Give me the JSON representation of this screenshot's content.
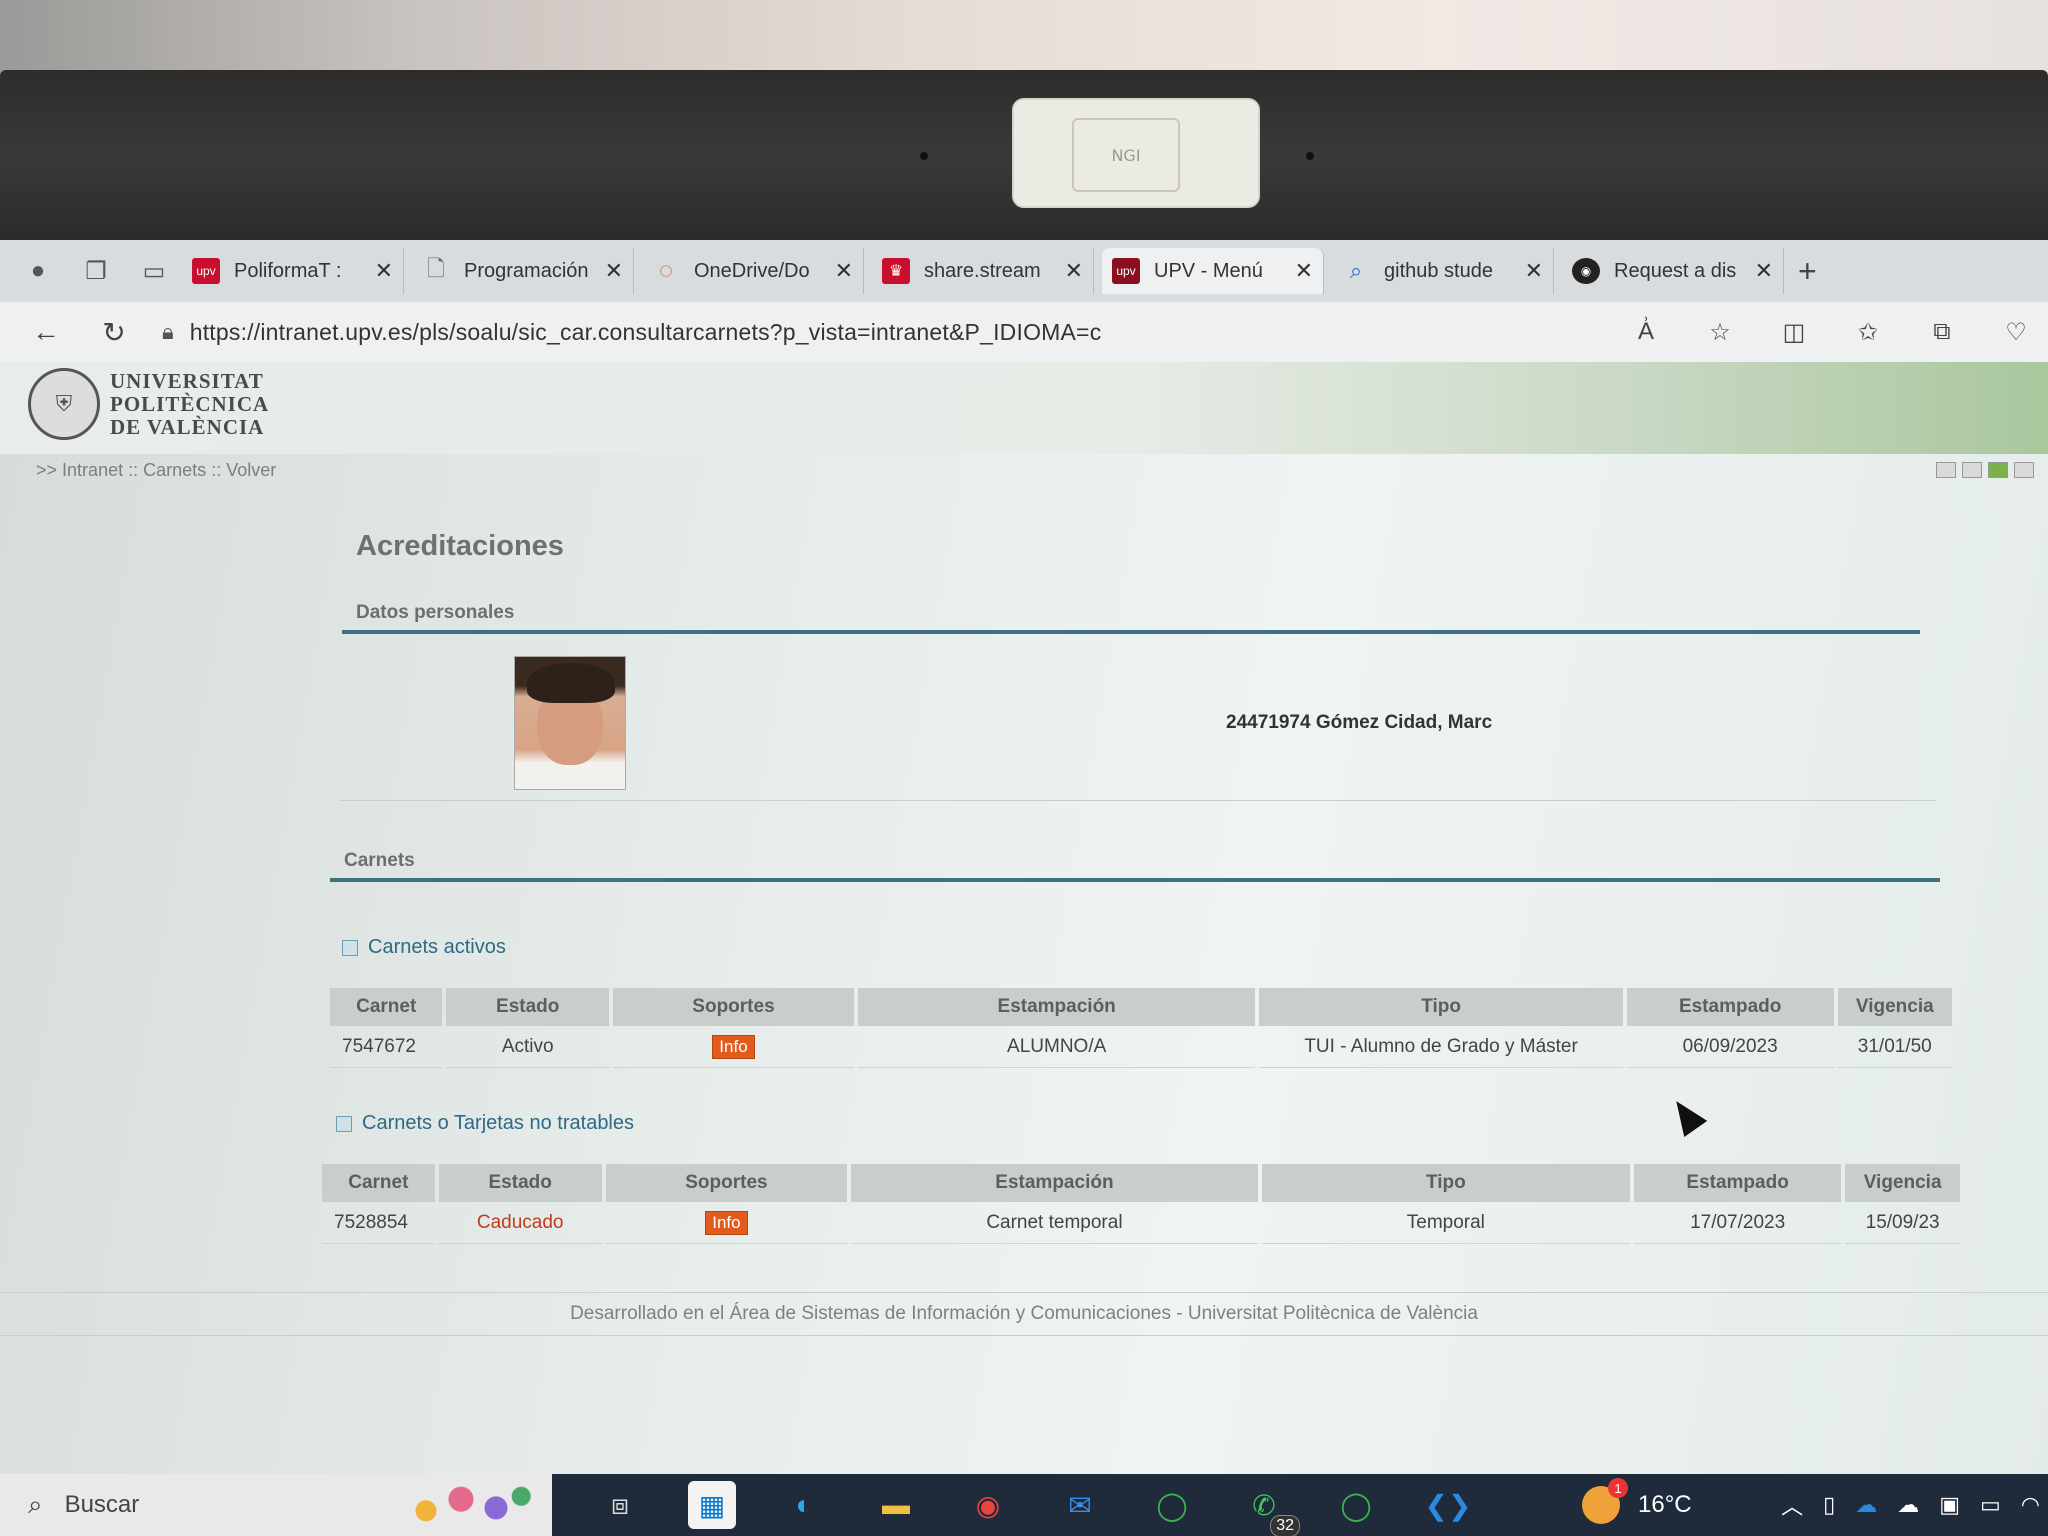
{
  "webcam_cover": {
    "label": "NGI"
  },
  "browser": {
    "tabs": [
      {
        "title": "PoliformaT : ",
        "favicon": "upv",
        "favicon_color": "#c8102e",
        "active": false
      },
      {
        "title": "Programación",
        "favicon": "doc",
        "favicon_color": "#888888",
        "active": false
      },
      {
        "title": "OneDrive/Do",
        "favicon": "onedrive",
        "favicon_color": "#e05a2a",
        "active": false
      },
      {
        "title": "share.stream",
        "favicon": "crown",
        "favicon_color": "#c8102e",
        "active": false
      },
      {
        "title": "UPV - Menú ",
        "favicon": "upv",
        "favicon_color": "#8a1020",
        "active": true
      },
      {
        "title": "github stude",
        "favicon": "search",
        "favicon_color": "#2a6adf",
        "active": false
      },
      {
        "title": "Request a dis",
        "favicon": "github",
        "favicon_color": "#222222",
        "active": false
      }
    ],
    "url": "https://intranet.upv.es/pls/soalu/sic_car.consultarcarnets?p_vista=intranet&P_IDIOMA=c"
  },
  "header": {
    "logo_lines": [
      "UNIVERSITAT",
      "POLITÈCNICA",
      "DE VALÈNCIA"
    ]
  },
  "breadcrumb": {
    "prefix": ">>",
    "items": [
      "Intranet",
      "Carnets",
      "Volver"
    ],
    "separator": "::"
  },
  "main": {
    "title": "Acreditaciones",
    "personal_section": "Datos personales",
    "person": "24471974 Gómez Cidad, Marc",
    "carnets_section": "Carnets",
    "active_heading": "Carnets activos",
    "untreatable_heading": "Carnets o Tarjetas no tratables",
    "columns": [
      "Carnet",
      "Estado",
      "Soportes",
      "Estampación",
      "Tipo",
      "Estampado",
      "Vigencia"
    ],
    "active_rows": [
      {
        "carnet": "7547672",
        "estado": "Activo",
        "soporte": "Info",
        "estampacion": "ALUMNO/A",
        "tipo": "TUI - Alumno de Grado y Máster",
        "estampado": "06/09/2023",
        "vigencia": "31/01/50"
      }
    ],
    "untreatable_rows": [
      {
        "carnet": "7528854",
        "estado": "Caducado",
        "soporte": "Info",
        "estampacion": "Carnet temporal",
        "tipo": "Temporal",
        "estampado": "17/07/2023",
        "vigencia": "15/09/23"
      }
    ],
    "status_colors": {
      "expired": "#c33a1c",
      "info_button": "#e35a1d",
      "rule": "#3e6f84"
    }
  },
  "footer": {
    "text": "Desarrollado en el Área de Sistemas de Información y Comunicaciones - Universitat Politècnica de València"
  },
  "taskbar": {
    "search_placeholder": "Buscar",
    "whatsapp_badge": "32",
    "weather_temp": "16°C",
    "weather_badge": "1"
  }
}
